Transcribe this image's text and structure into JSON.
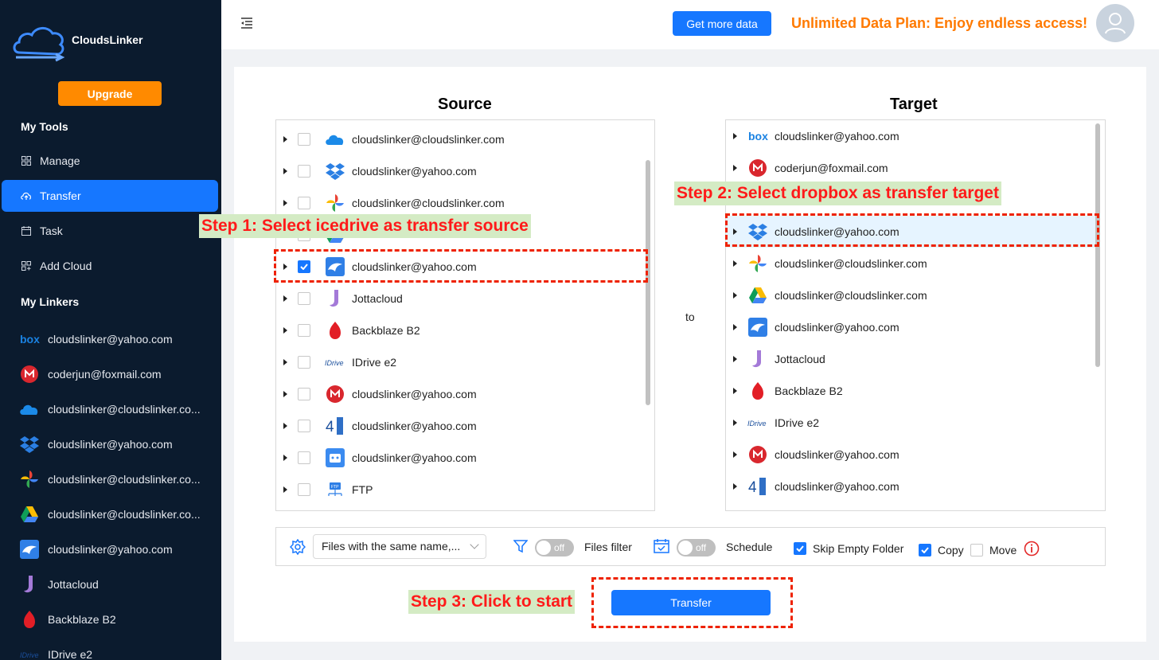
{
  "app": {
    "name": "CloudsLinker",
    "upgrade_label": "Upgrade"
  },
  "sidebar": {
    "my_tools_title": "My Tools",
    "tools": [
      {
        "label": "Manage",
        "icon": "grid-icon"
      },
      {
        "label": "Transfer",
        "icon": "cloud-upload-icon",
        "active": true
      },
      {
        "label": "Task",
        "icon": "calendar-icon"
      },
      {
        "label": "Add Cloud",
        "icon": "add-grid-icon"
      }
    ],
    "my_linkers_title": "My Linkers",
    "linkers": [
      {
        "label": "cloudslinker@yahoo.com",
        "icon": "box-icon"
      },
      {
        "label": "coderjun@foxmail.com",
        "icon": "mega-icon"
      },
      {
        "label": "cloudslinker@cloudslinker.co...",
        "icon": "onedrive-icon"
      },
      {
        "label": "cloudslinker@yahoo.com",
        "icon": "dropbox-icon"
      },
      {
        "label": "cloudslinker@cloudslinker.co...",
        "icon": "google-photos-icon"
      },
      {
        "label": "cloudslinker@cloudslinker.co...",
        "icon": "google-drive-icon"
      },
      {
        "label": "cloudslinker@yahoo.com",
        "icon": "icedrive-icon"
      },
      {
        "label": "Jottacloud",
        "icon": "jottacloud-icon"
      },
      {
        "label": "Backblaze B2",
        "icon": "backblaze-icon"
      },
      {
        "label": "IDrive e2",
        "icon": "idrive-icon"
      }
    ]
  },
  "header": {
    "get_more_data_label": "Get more data",
    "promo_text": "Unlimited Data Plan: Enjoy endless access!"
  },
  "source": {
    "title": "Source",
    "rows": [
      {
        "label": "cloudslinker@cloudslinker.com",
        "icon": "onedrive-icon",
        "checked": false
      },
      {
        "label": "cloudslinker@yahoo.com",
        "icon": "dropbox-icon",
        "checked": false
      },
      {
        "label": "cloudslinker@cloudslinker.com",
        "icon": "google-photos-icon",
        "checked": false
      },
      {
        "label": "",
        "icon": "google-drive-icon",
        "checked": false
      },
      {
        "label": "cloudslinker@yahoo.com",
        "icon": "icedrive-icon",
        "checked": true
      },
      {
        "label": "Jottacloud",
        "icon": "jottacloud-icon",
        "checked": false
      },
      {
        "label": "Backblaze B2",
        "icon": "backblaze-icon",
        "checked": false
      },
      {
        "label": "IDrive e2",
        "icon": "idrive-icon",
        "checked": false
      },
      {
        "label": "cloudslinker@yahoo.com",
        "icon": "mega-icon",
        "checked": false
      },
      {
        "label": "cloudslinker@yahoo.com",
        "icon": "4shared-icon",
        "checked": false
      },
      {
        "label": "cloudslinker@yahoo.com",
        "icon": "bot-cloud-icon",
        "checked": false
      },
      {
        "label": "FTP",
        "icon": "ftp-icon",
        "checked": false
      }
    ]
  },
  "to_label": "to",
  "target": {
    "title": "Target",
    "rows": [
      {
        "label": "cloudslinker@yahoo.com",
        "icon": "box-icon"
      },
      {
        "label": "coderjun@foxmail.com",
        "icon": "mega-icon"
      },
      {
        "label": "",
        "icon": "onedrive-icon"
      },
      {
        "label": "cloudslinker@yahoo.com",
        "icon": "dropbox-icon",
        "selected": true
      },
      {
        "label": "cloudslinker@cloudslinker.com",
        "icon": "google-photos-icon"
      },
      {
        "label": "cloudslinker@cloudslinker.com",
        "icon": "google-drive-icon"
      },
      {
        "label": "cloudslinker@yahoo.com",
        "icon": "icedrive-icon"
      },
      {
        "label": "Jottacloud",
        "icon": "jottacloud-icon"
      },
      {
        "label": "Backblaze B2",
        "icon": "backblaze-icon"
      },
      {
        "label": "IDrive e2",
        "icon": "idrive-icon"
      },
      {
        "label": "cloudslinker@yahoo.com",
        "icon": "mega-icon"
      },
      {
        "label": "cloudslinker@yahoo.com",
        "icon": "4shared-icon"
      }
    ]
  },
  "options": {
    "conflict_select_value": "Files with the same name,...",
    "files_filter_toggle": "off",
    "files_filter_label": "Files filter",
    "schedule_toggle": "off",
    "schedule_label": "Schedule",
    "skip_empty_label": "Skip Empty Folder",
    "skip_empty_checked": true,
    "copy_label": "Copy",
    "copy_checked": true,
    "move_label": "Move",
    "move_checked": false
  },
  "transfer_button_label": "Transfer",
  "annotations": {
    "step1": "Step 1: Select icedrive as transfer source",
    "step2": "Step 2: Select dropbox as transfer target",
    "step3": "Step 3: Click to start"
  },
  "colors": {
    "sidebar_bg": "#0b1b2e",
    "accent": "#1677ff",
    "promo": "#ff7a00",
    "upgrade": "#ff8a00",
    "annotation_text": "#ff1a1a",
    "annotation_bg": "#d4ebc4"
  }
}
